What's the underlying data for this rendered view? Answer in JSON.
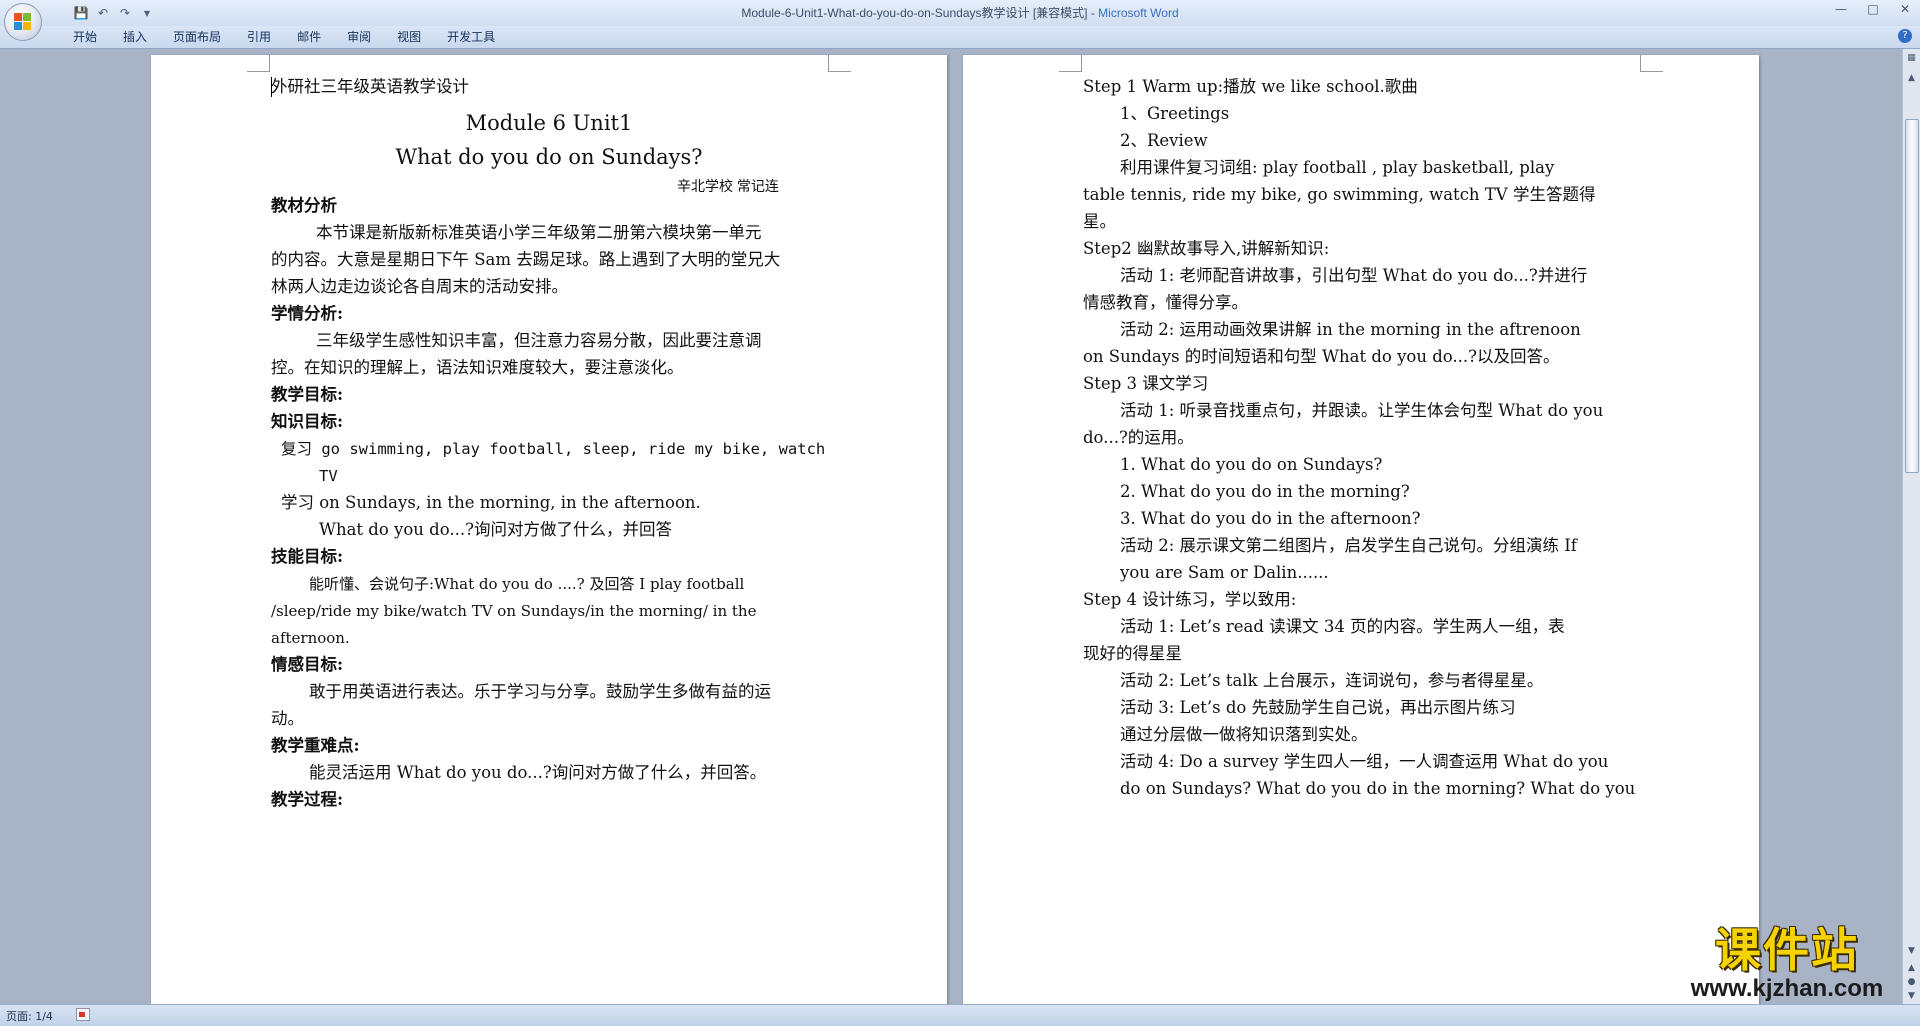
{
  "window": {
    "title": "Module-6-Unit1-What-do-you-do-on-Sundays教学设计 [兼容模式] - ",
    "app_name": "Microsoft Word",
    "minimize": "—",
    "maximize": "□",
    "close": "✕"
  },
  "ribbon": {
    "tabs": [
      "开始",
      "插入",
      "页面布局",
      "引用",
      "邮件",
      "审阅",
      "视图",
      "开发工具"
    ]
  },
  "page1": {
    "header_line": "外研社三年级英语教学设计",
    "title1": "Module 6 Unit1",
    "title2": "What do you do on Sundays?",
    "author": "辛北学校   常记连",
    "s1_head": "教材分析",
    "s1_p1": "本节课是新版新标准英语小学三年级第二册第六模块第一单元",
    "s1_p2": "的内容。大意是星期日下午 Sam 去踢足球。路上遇到了大明的堂兄大",
    "s1_p3": "林两人边走边谈论各自周末的活动安排。",
    "s2_head": "学情分析:",
    "s2_p1": "三年级学生感性知识丰富，但注意力容易分散，因此要注意调",
    "s2_p2": "控。在知识的理解上，语法知识难度较大，要注意淡化。",
    "s3_head": "教学目标:",
    "s4_head": "知识目标:",
    "s4_l1": "复习 go swimming, play football, sleep, ride my bike, watch",
    "s4_l2": "TV",
    "s4_l3": "学习 on Sundays, in the morning, in the afternoon.",
    "s4_l4": "What do you do...?询问对方做了什么，并回答",
    "s5_head": "技能目标:",
    "s5_p1": "能听懂、会说句子:What do you do ....?  及回答 I play football",
    "s5_p2": "/sleep/ride my bike/watch TV on Sundays/in the morning/ in the",
    "s5_p3": "afternoon.",
    "s6_head": "情感目标:",
    "s6_p1": "敢于用英语进行表达。乐于学习与分享。鼓励学生多做有益的运",
    "s6_p2": "动。",
    "s7_head": "教学重难点:",
    "s7_p1": "能灵活运用 What do you do...?询问对方做了什么，并回答。",
    "s8_head": "教学过程:"
  },
  "page2": {
    "l01": "Step 1 Warm up:播放 we like school.歌曲",
    "l02": "1、Greetings",
    "l03": "2、Review",
    "l04": "利用课件复习词组: play football , play basketball, play",
    "l05": "table tennis, ride my bike, go swimming, watch TV 学生答题得",
    "l06": "星。",
    "l07": "Step2 幽默故事导入,讲解新知识:",
    "l08": "活动 1: 老师配音讲故事，引出句型 What do you do...?并进行",
    "l09": "情感教育，懂得分享。",
    "l10": "活动 2: 运用动画效果讲解 in the morning  in the aftrenoon",
    "l11": "on Sundays 的时间短语和句型 What do you do...?以及回答。",
    "l12": "Step 3 课文学习",
    "l13": "活动 1:  听录音找重点句，并跟读。让学生体会句型 What do you",
    "l14": "do...?的运用。",
    "l15": "1. What do you do on Sundays?",
    "l16": "2. What do you do in the morning?",
    "l17": "3. What do you do in the afternoon?",
    "l18": "活动 2: 展示课文第二组图片，启发学生自己说句。分组演练 If",
    "l19": "you are Sam or Dalin......",
    "l20": "Step 4 设计练习，学以致用:",
    "l21": "活动 1: Let’s read 读课文 34 页的内容。学生两人一组，表",
    "l22": "现好的得星星",
    "l23": "活动 2: Let’s talk  上台展示，连词说句，参与者得星星。",
    "l24": "活动 3: Let’s do 先鼓励学生自己说，再出示图片练习",
    "l25": "通过分层做一做将知识落到实处。",
    "l26": "活动 4: Do a survey 学生四人一组，一人调查运用 What do you",
    "l27": "do on Sundays? What do you do in the morning? What do you"
  },
  "status": {
    "page_count": "页面: 1/4"
  },
  "watermark": {
    "text_cn": "课件站",
    "url": "www.kjzhan.com"
  },
  "colors": {
    "workspace": "#a8b4c6",
    "titlebar": "#dae6f6",
    "app_name": "#3b6fbe",
    "watermark": "#f6d300"
  }
}
